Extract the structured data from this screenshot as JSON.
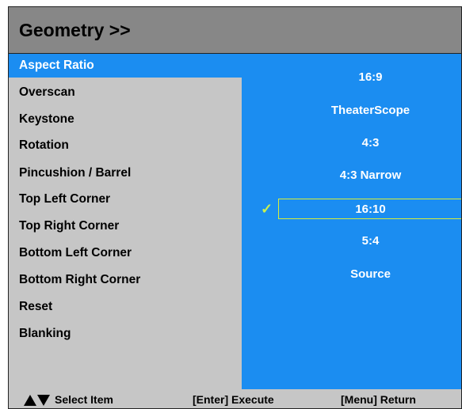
{
  "header": {
    "title": "Geometry >>"
  },
  "menu": {
    "items": [
      {
        "label": "Aspect Ratio",
        "selected": true
      },
      {
        "label": "Overscan"
      },
      {
        "label": "Keystone"
      },
      {
        "label": "Rotation"
      },
      {
        "label": "Pincushion / Barrel"
      },
      {
        "label": "Top Left Corner"
      },
      {
        "label": "Top Right Corner"
      },
      {
        "label": "Bottom Left Corner"
      },
      {
        "label": "Bottom Right Corner"
      },
      {
        "label": "Reset"
      },
      {
        "label": "Blanking"
      }
    ]
  },
  "options": {
    "items": [
      "16:9",
      "TheaterScope",
      "4:3",
      "4:3 Narrow",
      "16:10",
      "5:4",
      "Source"
    ],
    "current": "16:10",
    "check_mark": "✓"
  },
  "footer": {
    "select_hint": "Select Item",
    "execute_hint": "[Enter] Execute",
    "return_hint": "[Menu] Return"
  },
  "colors": {
    "accent_blue": "#1b8df1",
    "panel_gray": "#c6c6c6",
    "header_gray": "#878787",
    "check_green": "#c8f050",
    "outline_yellow": "#d8ee3a"
  }
}
